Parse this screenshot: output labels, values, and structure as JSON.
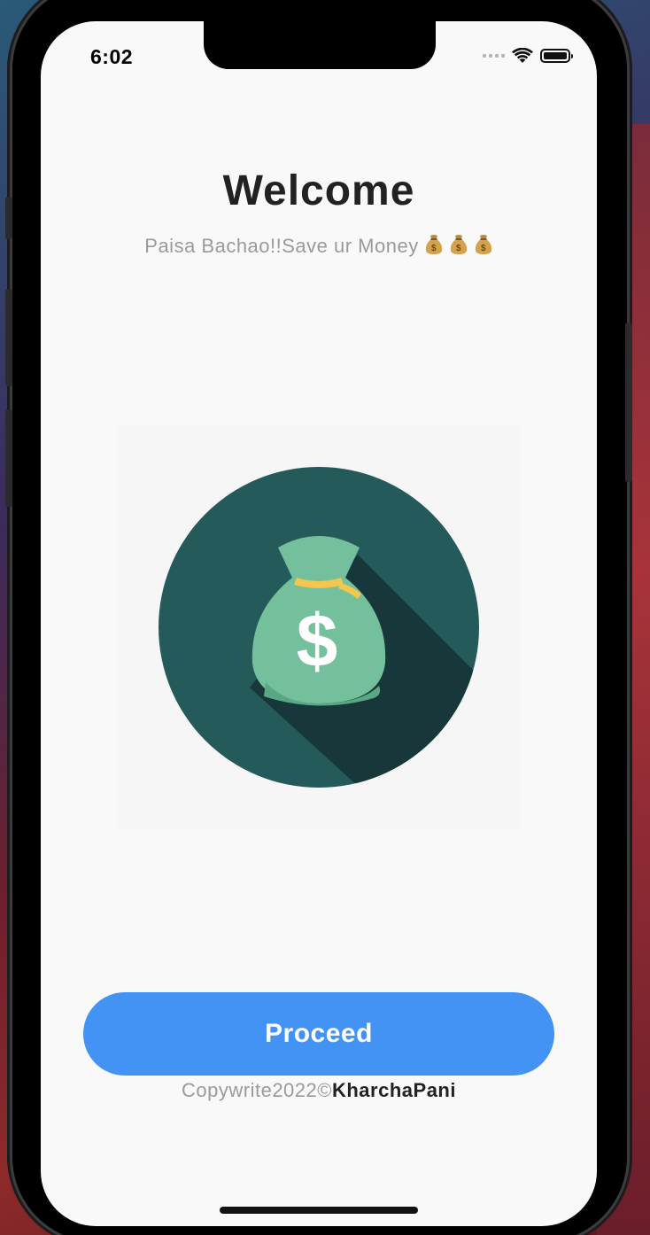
{
  "status_bar": {
    "time": "6:02",
    "wifi_icon": "wifi-icon",
    "battery_icon": "battery-icon"
  },
  "welcome": {
    "title": "Welcome",
    "subtitle": "Paisa Bachao!!Save ur Money",
    "subtitle_emoji": [
      "money-bag-icon",
      "money-bag-icon",
      "money-bag-icon"
    ]
  },
  "illustration": {
    "icon": "money-bag-dollar-icon",
    "colors": {
      "circle": "#255a5a",
      "shadow": "#17373b",
      "bag": "#74c09c",
      "bag_dark": "#5aa883",
      "tie": "#f3c64f",
      "dollar": "#ffffff"
    }
  },
  "actions": {
    "proceed_label": "Proceed",
    "accent": "#4393f4"
  },
  "footer": {
    "copyright_prefix": "Copywrite2022©",
    "brand": "KharchaPani"
  }
}
